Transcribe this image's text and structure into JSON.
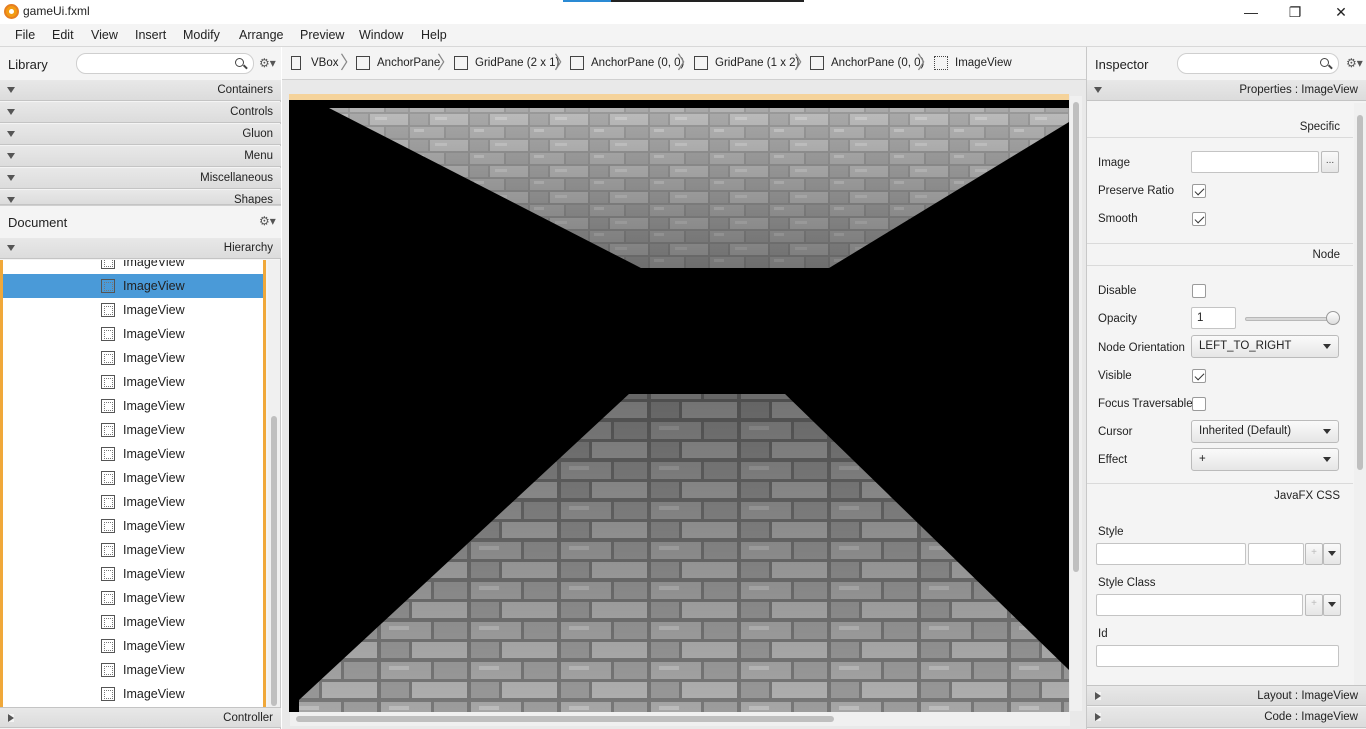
{
  "window": {
    "title": "gameUi.fxml",
    "minimize": "—",
    "maximize": "❐",
    "close": "✕"
  },
  "menu": [
    "File",
    "Edit",
    "View",
    "Insert",
    "Modify",
    "Arrange",
    "Preview",
    "Window",
    "Help"
  ],
  "library": {
    "title": "Library",
    "sections": [
      "Containers",
      "Controls",
      "Gluon",
      "Menu",
      "Miscellaneous",
      "Shapes"
    ]
  },
  "document": {
    "title": "Document",
    "hierarchy_label": "Hierarchy",
    "rows": [
      "ImageView",
      "ImageView",
      "ImageView",
      "ImageView",
      "ImageView",
      "ImageView",
      "ImageView",
      "ImageView",
      "ImageView",
      "ImageView",
      "ImageView",
      "ImageView",
      "ImageView",
      "ImageView",
      "ImageView",
      "ImageView",
      "ImageView",
      "ImageView",
      "ImageView",
      "ImageView"
    ],
    "selected_index": 1,
    "controller_label": "Controller"
  },
  "breadcrumb": [
    "VBox",
    "AnchorPane",
    "GridPane (2 x 1)",
    "AnchorPane (0, 0)",
    "GridPane (1 x 2)",
    "AnchorPane (0, 0)",
    "ImageView"
  ],
  "inspector": {
    "title": "Inspector",
    "properties_header": "Properties : ImageView",
    "specific_title": "Specific",
    "image_label": "Image",
    "image_browse": "...",
    "preserve_ratio_label": "Preserve Ratio",
    "smooth_label": "Smooth",
    "node_title": "Node",
    "disable_label": "Disable",
    "opacity_label": "Opacity",
    "opacity_value": "1",
    "opacity_level": 1.0,
    "node_orientation_label": "Node Orientation",
    "node_orientation_value": "LEFT_TO_RIGHT",
    "visible_label": "Visible",
    "focus_traversable_label": "Focus Traversable",
    "cursor_label": "Cursor",
    "cursor_value": "Inherited (Default)",
    "effect_label": "Effect",
    "effect_value": "+",
    "css_title": "JavaFX CSS",
    "style_label": "Style",
    "style_class_label": "Style Class",
    "id_label": "Id",
    "plus": "+",
    "layout_header": "Layout : ImageView",
    "code_header": "Code : ImageView"
  },
  "colors": {
    "selection": "#4a9ad8",
    "focus_border": "#f0a83a"
  }
}
